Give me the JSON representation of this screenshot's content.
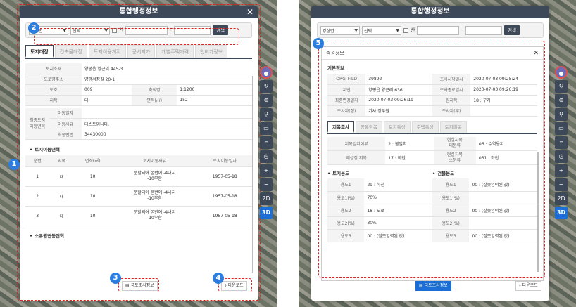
{
  "left": {
    "title": "통합행정정보",
    "close": "✕",
    "search": {
      "district": "강상면",
      "select": "선택",
      "mountain_label": "산",
      "button": "검색"
    },
    "tabs": [
      "토지대장",
      "건축물대장",
      "토지이용계획",
      "공시지가",
      "개별주택가격",
      "인허가정보"
    ],
    "info": {
      "location_k": "토지소재",
      "location_v": "양평읍 양근리 445-3",
      "road_k": "도로명주소",
      "road_v": "양평서정길 20-1",
      "lot_k": "도호",
      "lot_v": "009",
      "scale_k": "축척명",
      "scale_v": "1:1200",
      "jimok_k": "지목",
      "jimok_v": "대",
      "area_k": "면적(㎡)",
      "area_v": "152",
      "final_k": "최종토지\n이동연혁",
      "date_k": "이동일자",
      "date_v": "",
      "reason_k": "이동사유",
      "reason_v": "테스트입니다.",
      "num_k": "최종변번",
      "num_v": "34430000"
    },
    "history_title": "토지이동연혁",
    "history_cols": [
      "순번",
      "지목",
      "면적(㎡)",
      "토지이동사유",
      "토지이동일자"
    ],
    "history_rows": [
      [
        "1",
        "대",
        "10",
        "분할되어 본번에 -4내지\n-10부함",
        "1957-05-18"
      ],
      [
        "2",
        "대",
        "10",
        "분할되어 본번에 -4내지\n-10부함",
        "1957-05-18"
      ],
      [
        "3",
        "대",
        "10",
        "분할되어 본번에 -4내지\n-10부함",
        "1957-05-18"
      ]
    ],
    "owner_title": "소유권변동연혁",
    "btn_survey": "국토조사정보",
    "btn_download": "다운로드",
    "badges": [
      "1",
      "2",
      "3",
      "4"
    ]
  },
  "right": {
    "title": "통합행정정보",
    "search": {
      "district": "강상면",
      "select": "선택",
      "mountain_label": "산",
      "button": "검색"
    },
    "panel_title": "속성정보",
    "basic_title": "기본정보",
    "basic": [
      [
        "ORG_FILD",
        "39892",
        "조사시작일시",
        "2020-07-03 09:25:24"
      ],
      [
        "지번",
        "양평읍 양근리 636",
        "조사종료일시",
        "2020-07-03 09:26:19"
      ],
      [
        "최종변경일자",
        "2020-07-03 09:26:19",
        "원지목",
        "18 : 구거"
      ],
      [
        "조사자(정)",
        "기사 정두원",
        "조사자(부)",
        ""
      ]
    ],
    "subtabs": [
      "지목조사",
      "공통항목",
      "토지특성",
      "주택특성",
      "토지피복"
    ],
    "survey": [
      [
        "지목일치여부",
        "2 : 불일치",
        "현실지목\n대분류",
        "06 : 수역용지"
      ],
      [
        "재설정 지목",
        "17 : 하천",
        "현실지목\n소분류",
        "031 : 하천"
      ]
    ],
    "land_use_title": "토지용도",
    "building_use_title": "건물용도",
    "uses": [
      [
        "용도1",
        "29 : 하천",
        "용도1",
        "00 : (잘못입력된 값)"
      ],
      [
        "용도1(%)",
        "70%",
        "용도1(%)",
        ""
      ],
      [
        "용도2",
        "18 : 도로",
        "용도2",
        "00 : (잘못입력된 값)"
      ],
      [
        "용도2(%)",
        "30%",
        "용도2(%)",
        ""
      ],
      [
        "용도3",
        "00 : (잘못입력된 값)",
        "용도3",
        "00 : (잘못입력된 값)"
      ]
    ],
    "btn_survey": "국토조사정보",
    "btn_download": "다운로드",
    "badge": "5",
    "toolbar": [
      "●",
      "↻",
      "⊕",
      "⚲",
      "▭",
      "⌗",
      "◷",
      "+",
      "−",
      "2D",
      "3D"
    ]
  }
}
